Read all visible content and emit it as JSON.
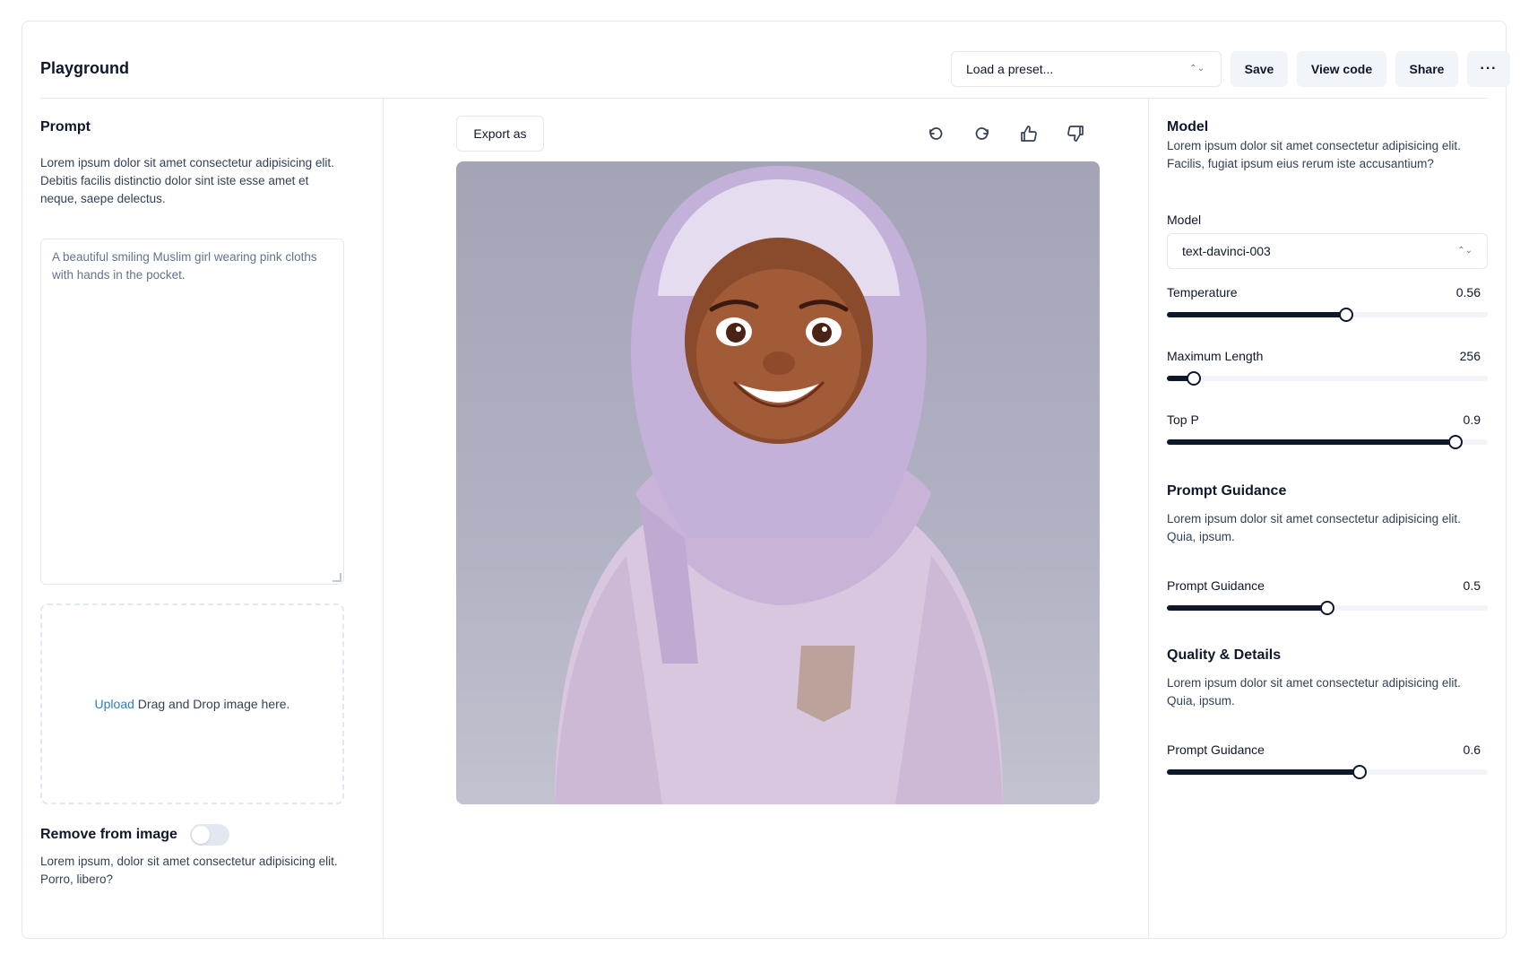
{
  "header": {
    "title": "Playground",
    "preset_placeholder": "Load a preset...",
    "save_label": "Save",
    "view_code_label": "View code",
    "share_label": "Share",
    "more_label": "···"
  },
  "left": {
    "prompt_title": "Prompt",
    "prompt_desc": "Lorem ipsum dolor sit amet consectetur adipisicing elit. Debitis facilis distinctio dolor sint iste esse amet et neque, saepe delectus.",
    "prompt_value": "A beautiful smiling Muslim girl wearing pink cloths with hands in the pocket.",
    "upload_link": "Upload",
    "upload_text": " Drag and Drop image here.",
    "remove_label": "Remove from image",
    "remove_toggle_on": false,
    "remove_desc": "Lorem ipsum, dolor sit amet consectetur adipisicing elit. Porro, libero?"
  },
  "middle": {
    "export_label": "Export as",
    "icons": [
      "undo-icon",
      "redo-icon",
      "thumbs-up-icon",
      "thumbs-down-icon"
    ]
  },
  "right": {
    "model_title": "Model",
    "model_desc": "Lorem ipsum dolor sit amet consectetur adipisicing elit. Facilis, fugiat ipsum eius rerum iste accusantium?",
    "model_label": "Model",
    "model_value": "text-davinci-003",
    "sliders": [
      {
        "label": "Temperature",
        "value": "0.56",
        "fraction": 0.56
      },
      {
        "label": "Maximum Length",
        "value": "256",
        "fraction": 0.085
      },
      {
        "label": "Top P",
        "value": "0.9",
        "fraction": 0.9
      }
    ],
    "guidance_title": "Prompt Guidance",
    "guidance_desc": "Lorem ipsum dolor sit amet consectetur adipisicing elit. Quia, ipsum.",
    "guidance_slider": {
      "label": "Prompt Guidance",
      "value": "0.5",
      "fraction": 0.5
    },
    "quality_title": "Quality & Details",
    "quality_desc": "Lorem ipsum dolor sit amet consectetur adipisicing elit. Quia, ipsum.",
    "quality_slider": {
      "label": "Prompt Guidance",
      "value": "0.6",
      "fraction": 0.6
    }
  }
}
